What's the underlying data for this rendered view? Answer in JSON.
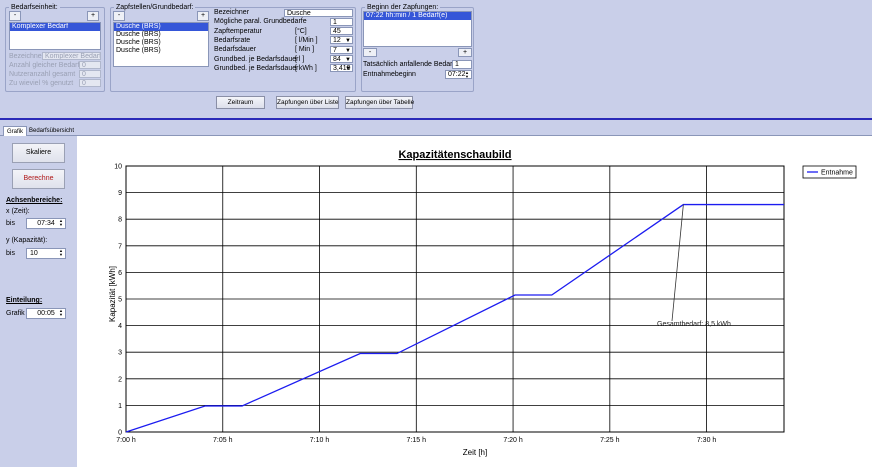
{
  "bedarfseinheit": {
    "legend": "Bedarfseinheit:",
    "minus": "-",
    "plus": "+",
    "items": [
      "Komplexer Bedarf"
    ],
    "selected_index": 0,
    "fields": [
      {
        "label": "Bezeichner",
        "value": "Komplexer Bedarf"
      },
      {
        "label": "Anzahl gleicher Bedarfe",
        "value": "0"
      },
      {
        "label": "Nutzeranzahl gesamt",
        "value": "0"
      },
      {
        "label": "Zu wieviel % genutzt",
        "value": "0"
      }
    ]
  },
  "zapfstellen": {
    "legend": "Zapfstellen/Grundbedarf:",
    "minus": "-",
    "plus": "+",
    "items": [
      "Dusche (BRS)",
      "Dusche (BRS)",
      "Dusche (BRS)",
      "Dusche (BRS)"
    ],
    "selected_index": 0,
    "properties": [
      {
        "label": "Bezeichner",
        "unit": "",
        "value": "Dusche",
        "dropdown": false
      },
      {
        "label": "Mögliche paral. Grundbedarfe",
        "unit": "",
        "value": "1",
        "dropdown": false
      },
      {
        "label": "Zapftemperatur",
        "unit": "[°C]",
        "value": "45",
        "dropdown": false
      },
      {
        "label": "Bedarfsrate",
        "unit": "[ l/Min ]",
        "value": "12",
        "dropdown": true
      },
      {
        "label": "Bedarfsdauer",
        "unit": "[ Min ]",
        "value": "7",
        "dropdown": true
      },
      {
        "label": "Grundbed. je Bedarfsdauer",
        "unit": "[ l ]",
        "value": "84",
        "dropdown": true
      },
      {
        "label": "Grundbed. je Bedarfsdauer",
        "unit": "[ kWh ]",
        "value": "3,419",
        "dropdown": true
      }
    ]
  },
  "zapfungen": {
    "legend": "Beginn der Zapfungen:",
    "items": [
      "07:22 hh:min / 1 Bedarf(e)"
    ],
    "selected_index": 0,
    "minus": "-",
    "plus": "+",
    "actual_label": "Tatsächlich anfallende Bedarfe",
    "actual_value": "1",
    "entnahme_label": "Entnahmebeginn",
    "entnahme_value": "07:22"
  },
  "buttons": {
    "zeitraum": "Zeitraum",
    "liste": "Zapfungen über Liste",
    "tabelle": "Zapfungen über Tabelle"
  },
  "tabs": [
    {
      "label": "Grafik",
      "active": true
    },
    {
      "label": "Bedarfsübersicht",
      "active": false
    }
  ],
  "left_panel": {
    "skaliere": "Skaliere",
    "berechne": "Berechne",
    "achsen_title": "Achsenbereiche:",
    "x_label": "x (Zeit):",
    "bis1": "bis",
    "x_value": "07:34",
    "y_label": "y (Kapazität):",
    "bis2": "bis",
    "y_value": "10",
    "einteilung_title": "Einteilung:",
    "grafik_label": "Grafik",
    "grafik_value": "00:05"
  },
  "chart_data": {
    "type": "line",
    "title": "Kapazitätenschaubild",
    "xlabel": "Zeit [h]",
    "ylabel": "Kapazität [kWh]",
    "x_tick_labels": [
      "7:00 h",
      "7:05 h",
      "7:10 h",
      "7:15 h",
      "7:20 h",
      "7:25 h",
      "7:30 h"
    ],
    "xlim_minutes": [
      0,
      34
    ],
    "ylim": [
      0,
      10
    ],
    "y_ticks": [
      0,
      1,
      2,
      3,
      4,
      5,
      6,
      7,
      8,
      9,
      10
    ],
    "legend_position": "top-right",
    "series": [
      {
        "name": "Entnahme",
        "color": "#1c1cf0",
        "x_minutes": [
          0,
          4.1,
          6,
          12.1,
          14,
          20.1,
          22,
          28.8,
          34
        ],
        "y": [
          0,
          0.98,
          0.98,
          2.95,
          2.95,
          5.15,
          5.15,
          8.55,
          8.55
        ]
      }
    ],
    "annotation": {
      "text": "Gesamtbedarf: 8,5 kWh",
      "x_minutes": 28.8,
      "y": 8.55
    }
  },
  "colors": {
    "panel_bg": "#c9cfe9",
    "accent_line": "#2a2ab8",
    "series": "#1c1cf0"
  }
}
